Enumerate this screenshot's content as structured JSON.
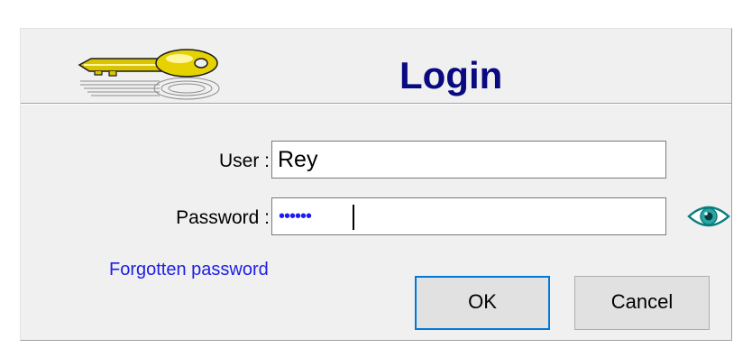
{
  "dialog": {
    "title": "Login",
    "icon": "key-icon"
  },
  "form": {
    "user_label": "User :",
    "user_value": "Rey",
    "password_label": "Password :",
    "password_masked": "••••••",
    "show_password_icon": "eye-icon",
    "forgot_link": "Forgotten password"
  },
  "buttons": {
    "ok_label": "OK",
    "cancel_label": "Cancel"
  },
  "colors": {
    "title": "#0a0a80",
    "link": "#1e1ee6",
    "password_dots": "#1d1df0",
    "dialog_bg": "#f0f0f0",
    "default_button_border": "#0078d7"
  }
}
